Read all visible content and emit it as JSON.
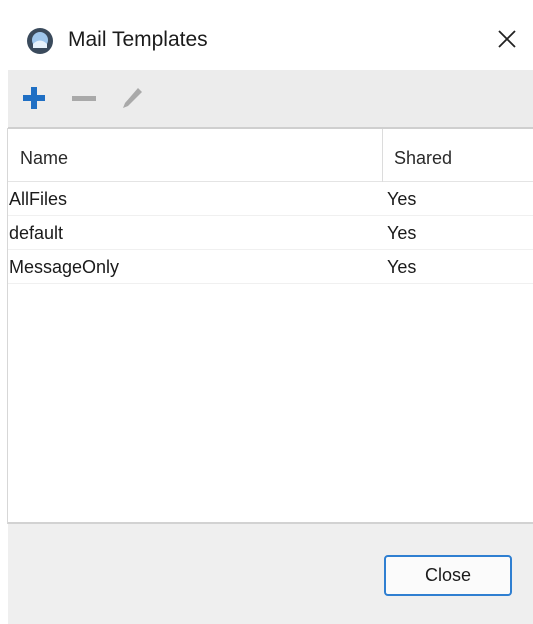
{
  "window": {
    "title": "Mail Templates",
    "close_icon": "close-icon",
    "app_icon": "app-logo-icon"
  },
  "toolbar": {
    "add_icon": "plus-icon",
    "remove_icon": "minus-icon",
    "edit_icon": "pencil-icon",
    "add_color": "#1f6fc4",
    "disabled_color": "#a9a9a9"
  },
  "table": {
    "columns": [
      "Name",
      "Shared"
    ],
    "rows": [
      {
        "name": "AllFiles",
        "shared": "Yes"
      },
      {
        "name": "default",
        "shared": "Yes"
      },
      {
        "name": "MessageOnly",
        "shared": "Yes"
      }
    ]
  },
  "footer": {
    "close_label": "Close",
    "accent": "#2f7fd1"
  }
}
